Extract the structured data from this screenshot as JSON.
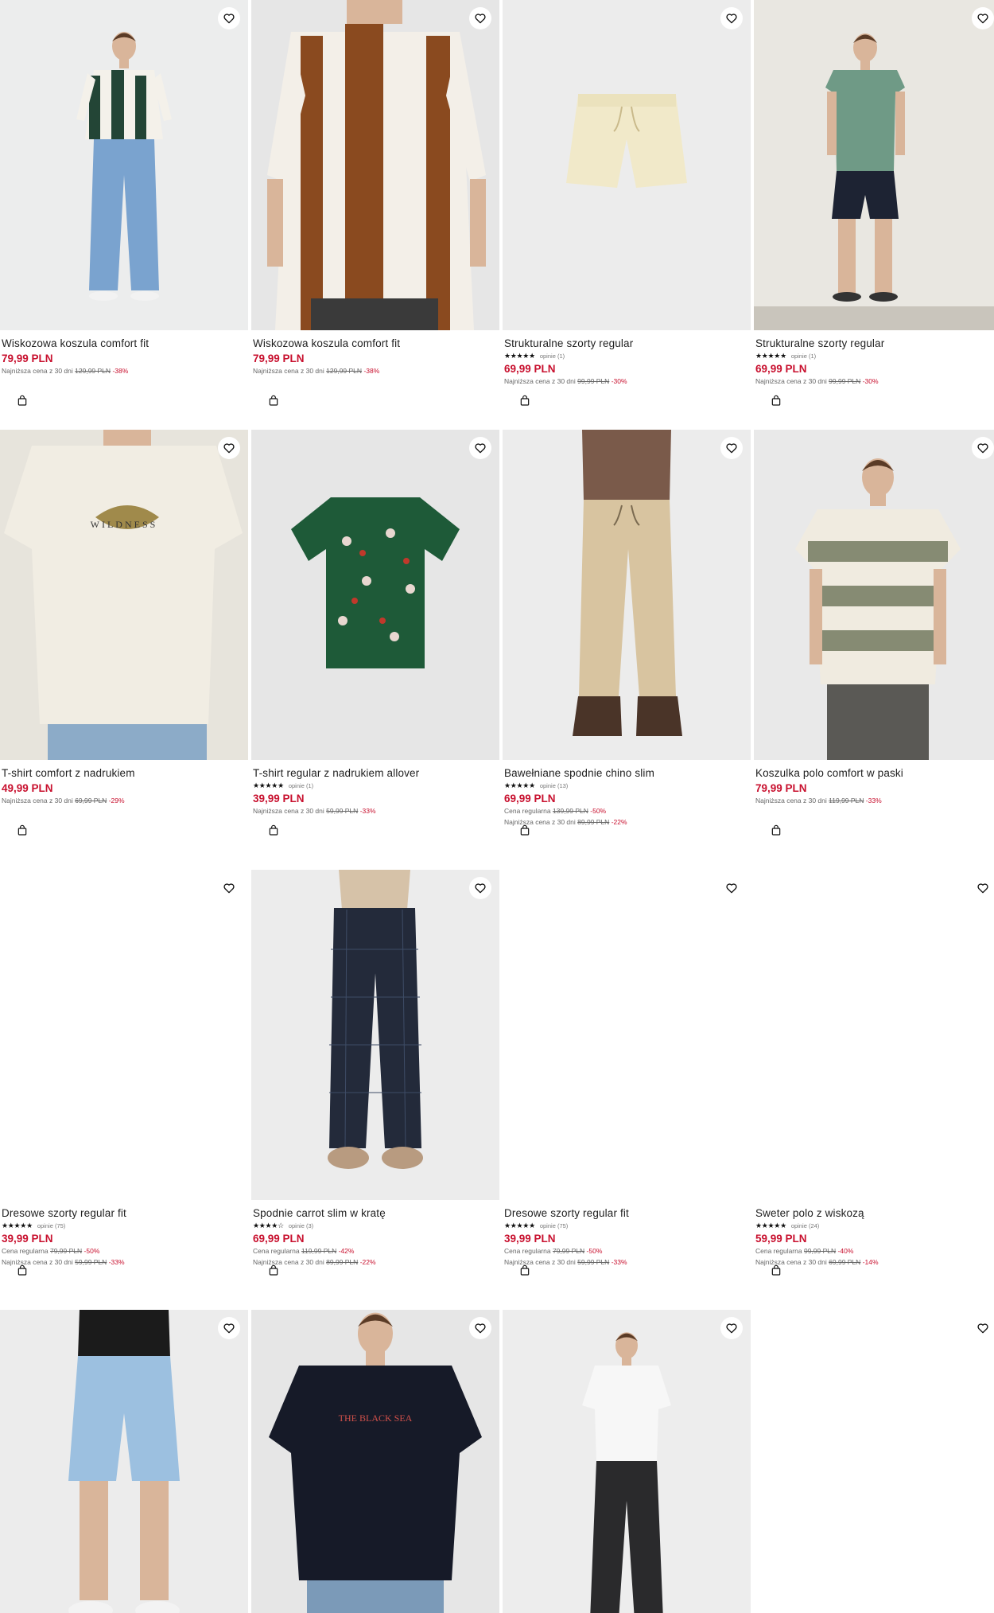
{
  "icons": {
    "heart": "heart-icon",
    "bag": "shopping-bag-icon",
    "star": "star-icon"
  },
  "colors": {
    "price": "#c8102e",
    "discount": "#c8102e",
    "text": "#1f1f1f",
    "muted": "#666666"
  },
  "products": [
    {
      "name": "Wiskozowa koszula comfort fit",
      "price": "79,99 PLN",
      "lines": [
        {
          "label": "Najniższa cena z 30 dni",
          "old": "129,99 PLN",
          "disc": "-38%"
        }
      ]
    },
    {
      "name": "Wiskozowa koszula comfort fit",
      "price": "79,99 PLN",
      "lines": [
        {
          "label": "Najniższa cena z 30 dni",
          "old": "129,99 PLN",
          "disc": "-38%"
        }
      ]
    },
    {
      "name": "Strukturalne szorty regular",
      "rating": 5,
      "stars": "★★★★★",
      "reviews": "opinie (1)",
      "price": "69,99 PLN",
      "lines": [
        {
          "label": "Najniższa cena z 30 dni",
          "old": "99,99 PLN",
          "disc": "-30%"
        }
      ]
    },
    {
      "name": "Strukturalne szorty regular",
      "rating": 5,
      "stars": "★★★★★",
      "reviews": "opinie (1)",
      "price": "69,99 PLN",
      "lines": [
        {
          "label": "Najniższa cena z 30 dni",
          "old": "99,99 PLN",
          "disc": "-30%"
        }
      ]
    },
    {
      "name": "T-shirt comfort z nadrukiem",
      "price": "49,99 PLN",
      "lines": [
        {
          "label": "Najniższa cena z 30 dni",
          "old": "69,99 PLN",
          "disc": "-29%"
        }
      ]
    },
    {
      "name": "T-shirt regular z nadrukiem allover",
      "rating": 5,
      "stars": "★★★★★",
      "reviews": "opinie (1)",
      "price": "39,99 PLN",
      "lines": [
        {
          "label": "Najniższa cena z 30 dni",
          "old": "59,99 PLN",
          "disc": "-33%"
        }
      ]
    },
    {
      "name": "Bawełniane spodnie chino slim",
      "rating": 5,
      "stars": "★★★★★",
      "reviews": "opinie (13)",
      "price": "69,99 PLN",
      "lines": [
        {
          "label": "Cena regularna",
          "old": "139,99 PLN",
          "disc": "-50%"
        },
        {
          "label": "Najniższa cena z 30 dni",
          "old": "89,99 PLN",
          "disc": "-22%"
        }
      ]
    },
    {
      "name": "Koszulka polo comfort w paski",
      "price": "79,99 PLN",
      "lines": [
        {
          "label": "Najniższa cena z 30 dni",
          "old": "119,99 PLN",
          "disc": "-33%"
        }
      ]
    },
    {
      "name": "Dresowe szorty regular fit",
      "rating": 5,
      "stars": "★★★★★",
      "reviews": "opinie (75)",
      "price": "39,99 PLN",
      "lines": [
        {
          "label": "Cena regularna",
          "old": "79,99 PLN",
          "disc": "-50%"
        },
        {
          "label": "Najniższa cena z 30 dni",
          "old": "59,99 PLN",
          "disc": "-33%"
        }
      ]
    },
    {
      "name": "Spodnie carrot slim w kratę",
      "rating": 4,
      "stars": "★★★★☆",
      "reviews": "opinie (3)",
      "price": "69,99 PLN",
      "lines": [
        {
          "label": "Cena regularna",
          "old": "119,99 PLN",
          "disc": "-42%"
        },
        {
          "label": "Najniższa cena z 30 dni",
          "old": "89,99 PLN",
          "disc": "-22%"
        }
      ]
    },
    {
      "name": "Dresowe szorty regular fit",
      "rating": 5,
      "stars": "★★★★★",
      "reviews": "opinie (75)",
      "price": "39,99 PLN",
      "lines": [
        {
          "label": "Cena regularna",
          "old": "79,99 PLN",
          "disc": "-50%"
        },
        {
          "label": "Najniższa cena z 30 dni",
          "old": "59,99 PLN",
          "disc": "-33%"
        }
      ]
    },
    {
      "name": "Sweter polo z wiskozą",
      "rating": 5,
      "stars": "★★★★★",
      "reviews": "opinie (24)",
      "price": "59,99 PLN",
      "lines": [
        {
          "label": "Cena regularna",
          "old": "99,99 PLN",
          "disc": "-40%"
        },
        {
          "label": "Najniższa cena z 30 dni",
          "old": "69,99 PLN",
          "disc": "-14%"
        }
      ]
    },
    {
      "name": ""
    },
    {
      "name": ""
    },
    {
      "name": ""
    },
    {
      "name": ""
    }
  ]
}
